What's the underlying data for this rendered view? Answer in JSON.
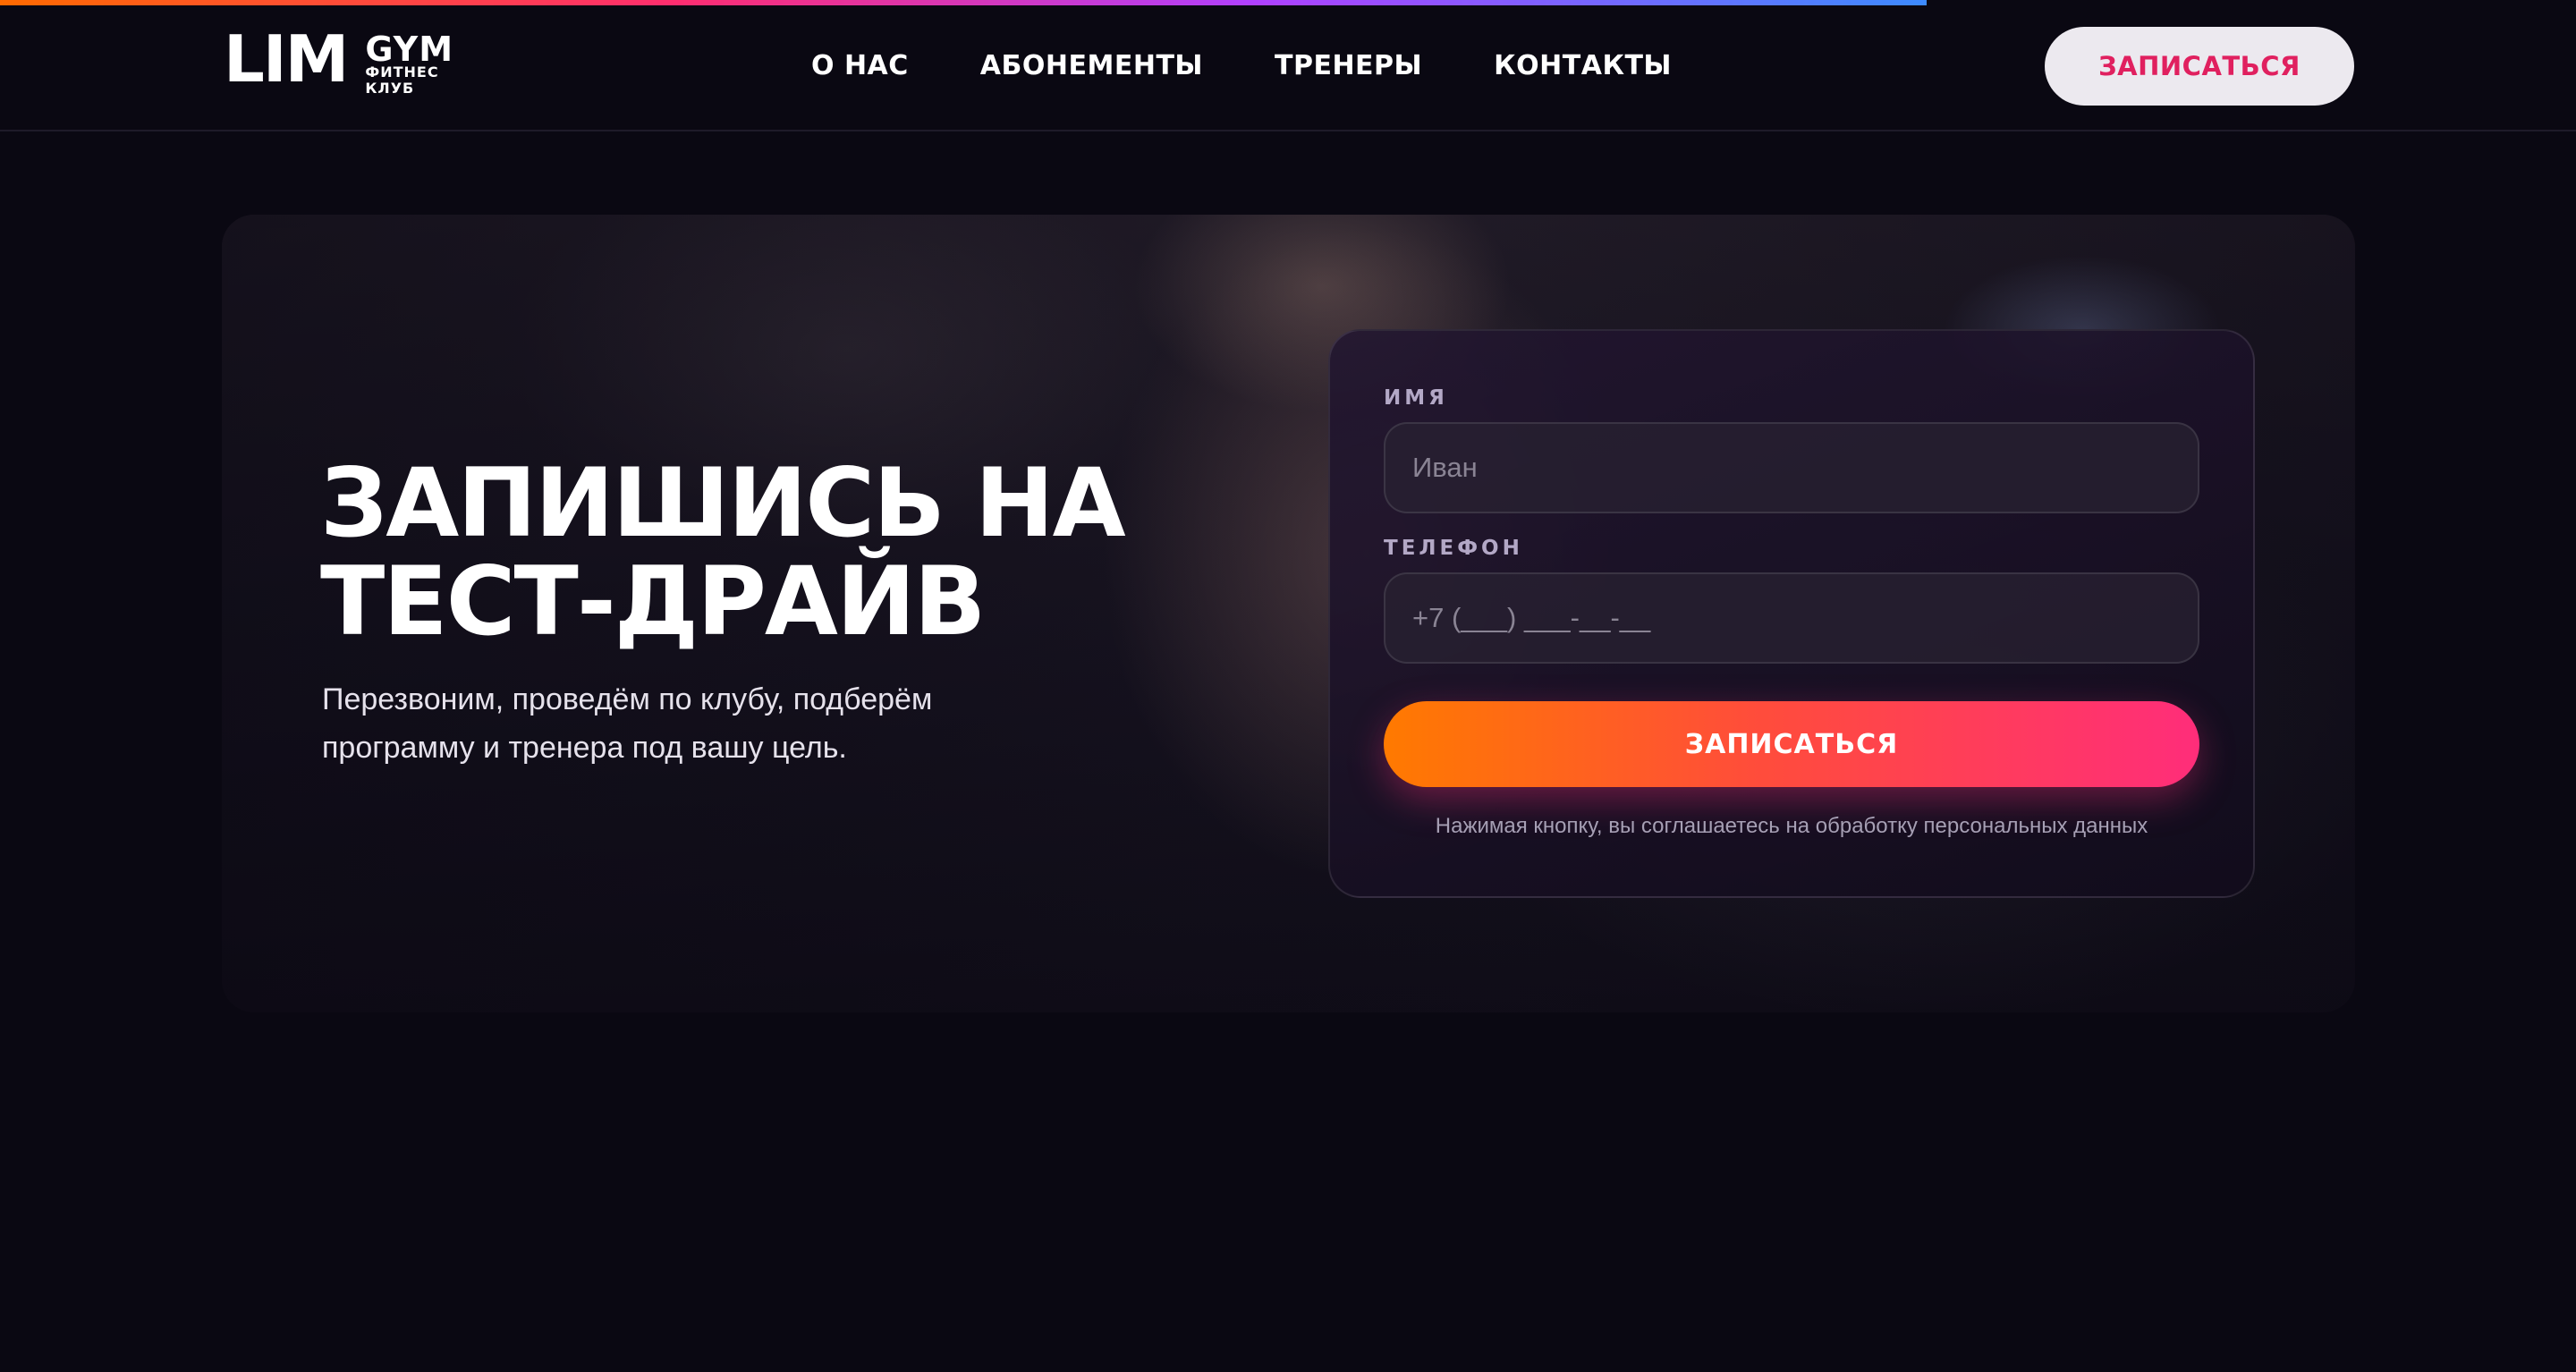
{
  "header": {
    "logo": {
      "main": "LIM",
      "brand": "GYM",
      "line1": "ФИТНЕС",
      "line2": "КЛУБ"
    },
    "nav": [
      {
        "label": "О НАС"
      },
      {
        "label": "АБОНЕМЕНТЫ"
      },
      {
        "label": "ТРЕНЕРЫ"
      },
      {
        "label": "КОНТАКТЫ"
      }
    ],
    "cta_label": "ЗАПИСАТЬСЯ"
  },
  "hero": {
    "title_line1": "ЗАПИШИСЬ НА",
    "title_line2": "ТЕСТ-ДРАЙВ",
    "subtitle_line1": "Перезвоним, проведём по клубу, подберём",
    "subtitle_line2": "программу и тренера под вашу цель."
  },
  "form": {
    "name_label": "ИМЯ",
    "name_placeholder": "Иван",
    "phone_label": "ТЕЛЕФОН",
    "phone_placeholder": "+7 (___) ___-__-__",
    "submit_label": "ЗАПИСАТЬСЯ",
    "consent": "Нажимая кнопку, вы соглашаетесь на обработку персональных данных"
  },
  "colors": {
    "background": "#0a0812",
    "accent_pink": "#e0205f",
    "gradient_start": "#ff7a00",
    "gradient_end": "#ff2d7a"
  }
}
